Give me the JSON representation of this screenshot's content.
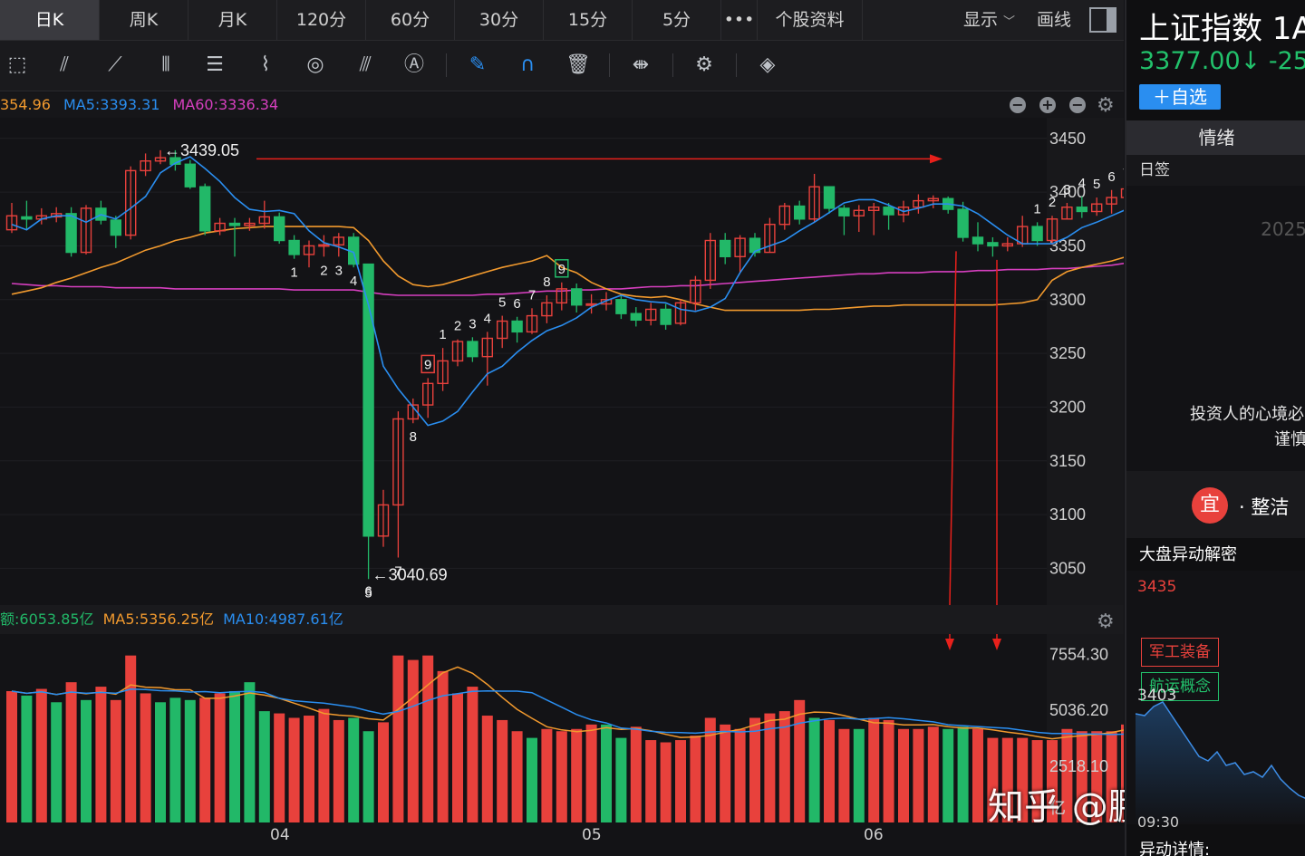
{
  "tabs": [
    "日K",
    "周K",
    "月K",
    "120分",
    "60分",
    "30分",
    "15分",
    "5分",
    "•••",
    "个股资料"
  ],
  "active_tab": "日K",
  "display_label": "显示",
  "draw_label": "画线",
  "ma_bar": {
    "close": "354.96",
    "ma5": "MA5:3393.31",
    "ma60": "MA60:3336.34"
  },
  "vol_bar": {
    "amount": "额:6053.85亿",
    "ma5": "MA5:5356.25亿",
    "ma10": "MA10:4987.61亿"
  },
  "chart_data": {
    "type": "candlestick",
    "yticks": [
      "3450",
      "3400",
      "3350",
      "3300",
      "3250",
      "3200",
      "3150",
      "3100",
      "3050"
    ],
    "ylim": [
      3020,
      3465
    ],
    "vol_yticks": [
      "7554.30",
      "5036.20",
      "2518.10",
      "亿"
    ],
    "vol_ylim": [
      0,
      8300
    ],
    "xlabels": [
      "04",
      "05",
      "06"
    ],
    "high_annotation": "←3439.05",
    "low_annotation": "←3040.69",
    "candles": [
      [
        3365,
        3378,
        3390,
        3362
      ],
      [
        3377,
        3375,
        3392,
        3365
      ],
      [
        3375,
        3378,
        3385,
        3370
      ],
      [
        3377,
        3380,
        3386,
        3372
      ],
      [
        3380,
        3344,
        3386,
        3340
      ],
      [
        3344,
        3385,
        3388,
        3342
      ],
      [
        3385,
        3374,
        3392,
        3370
      ],
      [
        3374,
        3360,
        3378,
        3348
      ],
      [
        3360,
        3420,
        3424,
        3356
      ],
      [
        3420,
        3429,
        3436,
        3415
      ],
      [
        3429,
        3432,
        3439,
        3426
      ],
      [
        3432,
        3426,
        3439,
        3420
      ],
      [
        3426,
        3405,
        3430,
        3403
      ],
      [
        3405,
        3364,
        3408,
        3360
      ],
      [
        3364,
        3371,
        3376,
        3360
      ],
      [
        3371,
        3369,
        3376,
        3340
      ],
      [
        3369,
        3371,
        3376,
        3364
      ],
      [
        3371,
        3377,
        3392,
        3366
      ],
      [
        3377,
        3355,
        3381,
        3352
      ],
      [
        3355,
        3342,
        3360,
        3338
      ],
      [
        3342,
        3350,
        3355,
        3330
      ],
      [
        3350,
        3351,
        3360,
        3340
      ],
      [
        3351,
        3358,
        3362,
        3340
      ],
      [
        3358,
        3333,
        3362,
        3330
      ],
      [
        3333,
        3080,
        3233,
        3040
      ],
      [
        3080,
        3109,
        3123,
        3070
      ],
      [
        3109,
        3189,
        3196,
        3060
      ],
      [
        3189,
        3202,
        3208,
        3185
      ],
      [
        3202,
        3222,
        3227,
        3190
      ],
      [
        3222,
        3243,
        3255,
        3215
      ],
      [
        3243,
        3261,
        3263,
        3238
      ],
      [
        3261,
        3247,
        3265,
        3242
      ],
      [
        3247,
        3264,
        3270,
        3220
      ],
      [
        3264,
        3280,
        3285,
        3255
      ],
      [
        3280,
        3270,
        3284,
        3260
      ],
      [
        3270,
        3285,
        3292,
        3268
      ],
      [
        3285,
        3297,
        3304,
        3278
      ],
      [
        3297,
        3310,
        3316,
        3290
      ],
      [
        3310,
        3295,
        3315,
        3288
      ],
      [
        3295,
        3296,
        3305,
        3287
      ],
      [
        3296,
        3300,
        3307,
        3290
      ],
      [
        3300,
        3287,
        3304,
        3282
      ],
      [
        3287,
        3281,
        3293,
        3275
      ],
      [
        3281,
        3291,
        3297,
        3276
      ],
      [
        3291,
        3277,
        3296,
        3272
      ],
      [
        3278,
        3297,
        3300,
        3276
      ],
      [
        3297,
        3318,
        3322,
        3290
      ],
      [
        3318,
        3355,
        3362,
        3310
      ],
      [
        3355,
        3340,
        3362,
        3333
      ],
      [
        3340,
        3357,
        3360,
        3325
      ],
      [
        3357,
        3344,
        3362,
        3340
      ],
      [
        3344,
        3370,
        3376,
        3344
      ],
      [
        3370,
        3387,
        3390,
        3365
      ],
      [
        3387,
        3375,
        3392,
        3370
      ],
      [
        3375,
        3405,
        3417,
        3372
      ],
      [
        3405,
        3385,
        3405,
        3380
      ],
      [
        3385,
        3378,
        3388,
        3360
      ],
      [
        3378,
        3383,
        3388,
        3363
      ],
      [
        3383,
        3386,
        3390,
        3360
      ],
      [
        3386,
        3379,
        3390,
        3365
      ],
      [
        3379,
        3386,
        3392,
        3372
      ],
      [
        3386,
        3392,
        3398,
        3380
      ],
      [
        3392,
        3394,
        3397,
        3385
      ],
      [
        3394,
        3384,
        3396,
        3380
      ],
      [
        3384,
        3358,
        3391,
        3354
      ],
      [
        3358,
        3352,
        3372,
        3345
      ],
      [
        3353,
        3350,
        3358,
        3340
      ],
      [
        3350,
        3352,
        3358,
        3345
      ],
      [
        3352,
        3368,
        3378,
        3349
      ],
      [
        3368,
        3355,
        3372,
        3350
      ],
      [
        3355,
        3375,
        3378,
        3351
      ],
      [
        3375,
        3386,
        3390,
        3375
      ],
      [
        3386,
        3382,
        3396,
        3376
      ],
      [
        3382,
        3389,
        3395,
        3378
      ],
      [
        3389,
        3395,
        3402,
        3380
      ],
      [
        3395,
        3403,
        3405,
        3385
      ],
      [
        3403,
        3390,
        3410,
        3366
      ],
      [
        3390,
        3403,
        3415,
        3388
      ],
      [
        3403,
        3400,
        3405,
        3392
      ],
      [
        3400,
        3377,
        3404,
        3370
      ]
    ],
    "volumes": [
      5900,
      5700,
      6000,
      5400,
      6300,
      5500,
      6100,
      5500,
      7500,
      5800,
      5400,
      5600,
      5500,
      5600,
      5800,
      5900,
      6300,
      5000,
      4900,
      4700,
      4800,
      5100,
      4600,
      4700,
      4100,
      4500,
      7500,
      7300,
      7500,
      6800,
      5800,
      6100,
      4800,
      4600,
      4100,
      3800,
      4200,
      4100,
      4200,
      4400,
      4400,
      3800,
      4300,
      3700,
      3600,
      3700,
      3900,
      4700,
      4400,
      4200,
      4700,
      4900,
      5000,
      5500,
      4700,
      4600,
      4200,
      4200,
      4700,
      4600,
      4200,
      4200,
      4300,
      4200,
      4300,
      4200,
      3800,
      3800,
      3800,
      3700,
      3700,
      4200,
      4100,
      4100,
      4100,
      4400,
      4800,
      5000,
      5400,
      5500,
      6700
    ],
    "vol_colors": "RGRGRGRRRRGGGRRGGGRRRRRGGRRRRRRRRRRGRRRRGGRRRRRRRRRRRRGRRGRRRRRGGRRRRRRRRRRRRRRRRG",
    "ma5": [
      3370,
      3365,
      3375,
      3378,
      3378,
      3372,
      3379,
      3375,
      3385,
      3396,
      3418,
      3427,
      3433,
      3422,
      3410,
      3395,
      3384,
      3382,
      3383,
      3380,
      3364,
      3353,
      3349,
      3344,
      3295,
      3238,
      3217,
      3200,
      3183,
      3187,
      3196,
      3214,
      3231,
      3238,
      3251,
      3262,
      3271,
      3276,
      3283,
      3293,
      3299,
      3304,
      3300,
      3298,
      3297,
      3291,
      3289,
      3293,
      3301,
      3325,
      3345,
      3350,
      3355,
      3364,
      3372,
      3381,
      3390,
      3393,
      3393,
      3388,
      3382,
      3385,
      3389,
      3389,
      3387,
      3380,
      3370,
      3360,
      3352,
      3352,
      3352,
      3358,
      3367,
      3372,
      3378,
      3384,
      3387,
      3390,
      3394,
      3397,
      3393
    ],
    "ma60": [
      3315,
      3314,
      3313,
      3313,
      3312,
      3312,
      3312,
      3311,
      3311,
      3311,
      3311,
      3310,
      3310,
      3310,
      3310,
      3310,
      3310,
      3310,
      3310,
      3309,
      3309,
      3309,
      3309,
      3309,
      3307,
      3305,
      3304,
      3304,
      3304,
      3304,
      3304,
      3304,
      3305,
      3305,
      3306,
      3307,
      3308,
      3308,
      3309,
      3309,
      3310,
      3310,
      3311,
      3312,
      3312,
      3313,
      3313,
      3314,
      3315,
      3316,
      3317,
      3318,
      3319,
      3320,
      3321,
      3322,
      3323,
      3324,
      3324,
      3325,
      3325,
      3325,
      3326,
      3326,
      3326,
      3327,
      3327,
      3328,
      3328,
      3328,
      3329,
      3329,
      3330,
      3331,
      3332,
      3334,
      3335,
      3335,
      3336,
      3337,
      3336
    ],
    "ma_orange": [
      3305,
      3308,
      3311,
      3316,
      3320,
      3325,
      3330,
      3334,
      3340,
      3346,
      3350,
      3355,
      3358,
      3362,
      3364,
      3366,
      3367,
      3368,
      3368,
      3368,
      3368,
      3368,
      3368,
      3367,
      3355,
      3336,
      3322,
      3314,
      3312,
      3314,
      3318,
      3322,
      3326,
      3330,
      3333,
      3336,
      3341,
      3330,
      3325,
      3316,
      3310,
      3305,
      3303,
      3302,
      3303,
      3300,
      3296,
      3293,
      3290,
      3290,
      3290,
      3290,
      3290,
      3290,
      3291,
      3291,
      3292,
      3293,
      3294,
      3294,
      3295,
      3295,
      3295,
      3295,
      3295,
      3295,
      3295,
      3296,
      3297,
      3300,
      3318,
      3326,
      3330,
      3333,
      3336,
      3340,
      3343,
      3346,
      3348,
      3351,
      3354
    ],
    "td_markers": [
      {
        "i": 19,
        "n": "1",
        "pos": "below"
      },
      {
        "i": 21,
        "n": "2",
        "pos": "below"
      },
      {
        "i": 22,
        "n": "3",
        "pos": "below"
      },
      {
        "i": 23,
        "n": "4",
        "pos": "below"
      },
      {
        "i": 24,
        "n": "5",
        "pos": "below"
      },
      {
        "i": 24,
        "n": "6",
        "pos": "lowbar"
      },
      {
        "i": 26,
        "n": "7",
        "pos": "below"
      },
      {
        "i": 27,
        "n": "8",
        "pos": "below"
      },
      {
        "i": 28,
        "n": "9",
        "pos": "above",
        "box": "red"
      },
      {
        "i": 29,
        "n": "1",
        "pos": "above"
      },
      {
        "i": 30,
        "n": "2",
        "pos": "above"
      },
      {
        "i": 31,
        "n": "3",
        "pos": "above"
      },
      {
        "i": 32,
        "n": "4",
        "pos": "above"
      },
      {
        "i": 33,
        "n": "5",
        "pos": "above"
      },
      {
        "i": 34,
        "n": "6",
        "pos": "above"
      },
      {
        "i": 35,
        "n": "7",
        "pos": "above"
      },
      {
        "i": 36,
        "n": "8",
        "pos": "above"
      },
      {
        "i": 37,
        "n": "9",
        "pos": "above",
        "box": "green"
      },
      {
        "i": 69,
        "n": "1",
        "pos": "above"
      },
      {
        "i": 70,
        "n": "2",
        "pos": "above"
      },
      {
        "i": 71,
        "n": "3",
        "pos": "above"
      },
      {
        "i": 72,
        "n": "4",
        "pos": "above"
      },
      {
        "i": 73,
        "n": "5",
        "pos": "above"
      },
      {
        "i": 74,
        "n": "6",
        "pos": "above"
      },
      {
        "i": 75,
        "n": "7",
        "pos": "above"
      },
      {
        "i": 76,
        "n": "8",
        "pos": "above"
      },
      {
        "i": 77,
        "n": "9",
        "pos": "above",
        "box": "green"
      }
    ]
  },
  "watermark": "知乎 @鹏哥投研",
  "right_panel": {
    "index_name": "上证指数  1A",
    "price": "3377.00↓ -25.",
    "add_button": "＋自选",
    "sentiment_tab": "情绪",
    "daily_sign": "日签",
    "year": "2025",
    "quote_line1": "投资人的心境必",
    "quote_line2": "谨慎",
    "yi": "宜",
    "yi_text": "· 整洁",
    "anomaly_title": "大盘异动解密",
    "anom_top": "3435",
    "tag_red": "军工装备",
    "tag_green": "航运概念",
    "anom_mid": "3403",
    "anom_time": "09:30",
    "detail": "异动详情:"
  },
  "colors": {
    "up": "#e8413c",
    "down": "#22b868",
    "ma5": "#2a8ef0",
    "ma60": "#d63fbf",
    "orange": "#f29a2e",
    "accent": "#2a8ef0"
  }
}
